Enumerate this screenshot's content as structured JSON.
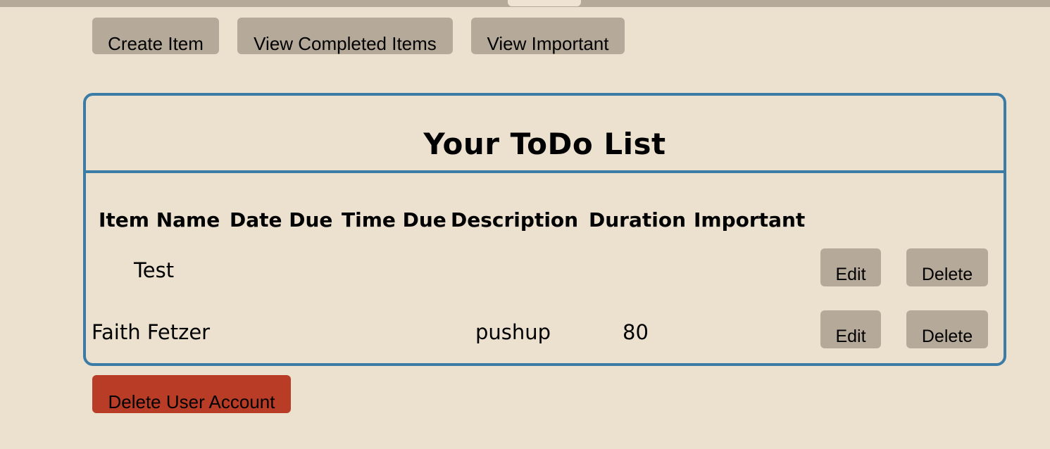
{
  "toolbar": {
    "create_label": "Create Item",
    "completed_label": "View Completed Items",
    "important_label": "View Important"
  },
  "todo": {
    "title": "Your ToDo List",
    "columns": [
      "Item Name",
      "Date Due",
      "Time Due",
      "Description",
      "Duration",
      "Important"
    ],
    "rows": [
      {
        "item_name": "Test",
        "date_due": "",
        "time_due": "",
        "description": "",
        "duration": "",
        "important": "",
        "edit_label": "Edit",
        "delete_label": "Delete"
      },
      {
        "item_name": "Faith Fetzer",
        "date_due": "",
        "time_due": "",
        "description": "pushup",
        "duration": "80",
        "important": "",
        "edit_label": "Edit",
        "delete_label": "Delete"
      }
    ]
  },
  "account": {
    "delete_label": "Delete User Account"
  },
  "colors": {
    "background": "#ece0ce",
    "button": "#b5a999",
    "panel_border": "#3b7ca6",
    "danger": "#b83c26"
  }
}
